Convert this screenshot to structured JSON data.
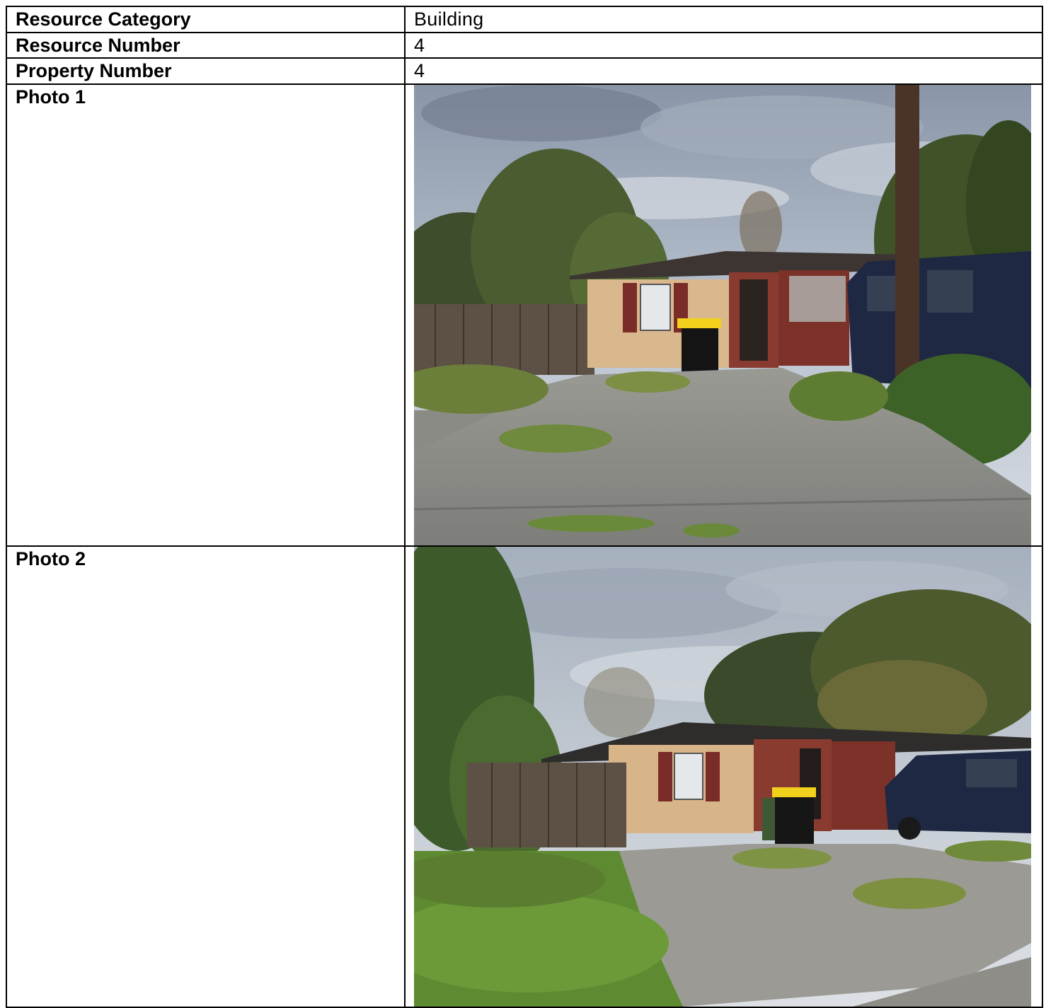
{
  "rows": {
    "resource_category": {
      "label": "Resource Category",
      "value": "Building"
    },
    "resource_number": {
      "label": "Resource Number",
      "value": "4"
    },
    "property_number": {
      "label": "Property Number",
      "value": "4"
    },
    "photo1": {
      "label": "Photo 1"
    },
    "photo2": {
      "label": "Photo 2"
    }
  }
}
